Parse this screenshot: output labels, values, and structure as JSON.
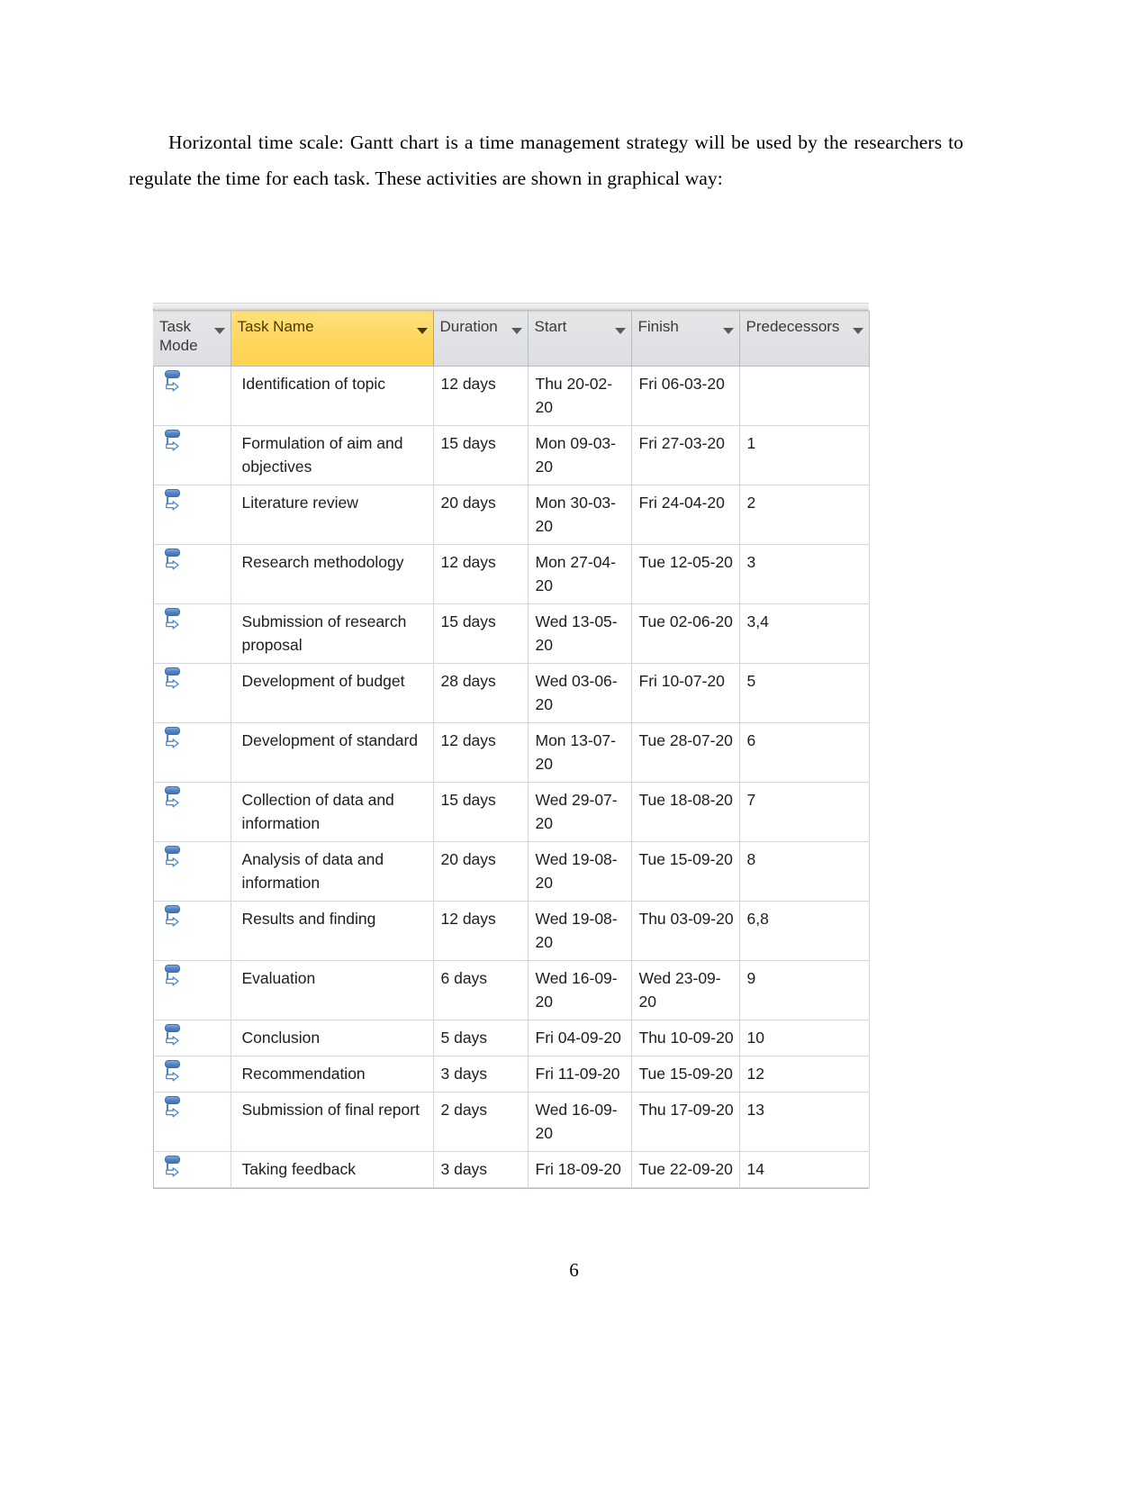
{
  "document": {
    "paragraph": "Horizontal time scale: Gantt chart is a time management strategy will be used by the researchers to regulate the time for each task. These activities are shown in graphical way:",
    "page_number": "6"
  },
  "gantt_table": {
    "highlight_color": "#ffd65e",
    "icon_color": "#4f85c8",
    "columns": [
      {
        "label": "Task Mode",
        "key": "task_mode",
        "highlighted": false
      },
      {
        "label": "Task Name",
        "key": "task_name",
        "highlighted": true
      },
      {
        "label": "Duration",
        "key": "duration",
        "highlighted": false
      },
      {
        "label": "Start",
        "key": "start",
        "highlighted": false
      },
      {
        "label": "Finish",
        "key": "finish",
        "highlighted": false
      },
      {
        "label": "Predecessors",
        "key": "predecessors",
        "highlighted": false
      }
    ],
    "rows": [
      {
        "mode_icon": "auto-scheduled-icon",
        "task_name": "Identification of topic",
        "duration": "12 days",
        "start": "Thu 20-02-20",
        "finish": "Fri 06-03-20",
        "predecessors": ""
      },
      {
        "mode_icon": "auto-scheduled-icon",
        "task_name": "Formulation of aim and objectives",
        "duration": "15 days",
        "start": "Mon 09-03-20",
        "finish": "Fri 27-03-20",
        "predecessors": "1"
      },
      {
        "mode_icon": "auto-scheduled-icon",
        "task_name": "Literature review",
        "duration": "20 days",
        "start": "Mon 30-03-20",
        "finish": "Fri 24-04-20",
        "predecessors": "2"
      },
      {
        "mode_icon": "auto-scheduled-icon",
        "task_name": "Research methodology",
        "duration": "12 days",
        "start": "Mon 27-04-20",
        "finish": "Tue 12-05-20",
        "predecessors": "3"
      },
      {
        "mode_icon": "auto-scheduled-icon",
        "task_name": "Submission of research proposal",
        "duration": "15 days",
        "start": "Wed 13-05-20",
        "finish": "Tue 02-06-20",
        "predecessors": "3,4"
      },
      {
        "mode_icon": "auto-scheduled-icon",
        "task_name": "Development of budget",
        "duration": "28 days",
        "start": "Wed 03-06-20",
        "finish": "Fri 10-07-20",
        "predecessors": "5"
      },
      {
        "mode_icon": "auto-scheduled-icon",
        "task_name": "Development of standard",
        "duration": "12 days",
        "start": "Mon 13-07-20",
        "finish": "Tue 28-07-20",
        "predecessors": "6"
      },
      {
        "mode_icon": "auto-scheduled-icon",
        "task_name": "Collection of data and information",
        "duration": "15 days",
        "start": "Wed 29-07-20",
        "finish": "Tue 18-08-20",
        "predecessors": "7"
      },
      {
        "mode_icon": "auto-scheduled-icon",
        "task_name": "Analysis of data and information",
        "duration": "20 days",
        "start": "Wed 19-08-20",
        "finish": "Tue 15-09-20",
        "predecessors": "8"
      },
      {
        "mode_icon": "auto-scheduled-icon",
        "task_name": "Results and finding",
        "duration": "12 days",
        "start": "Wed 19-08-20",
        "finish": "Thu 03-09-20",
        "predecessors": "6,8"
      },
      {
        "mode_icon": "auto-scheduled-icon",
        "task_name": "Evaluation",
        "duration": "6 days",
        "start": "Wed 16-09-20",
        "finish": "Wed 23-09-20",
        "predecessors": "9"
      },
      {
        "mode_icon": "auto-scheduled-icon",
        "task_name": "Conclusion",
        "duration": "5 days",
        "start": "Fri 04-09-20",
        "finish": "Thu 10-09-20",
        "predecessors": "10"
      },
      {
        "mode_icon": "auto-scheduled-icon",
        "task_name": "Recommendation",
        "duration": "3 days",
        "start": "Fri 11-09-20",
        "finish": "Tue 15-09-20",
        "predecessors": "12"
      },
      {
        "mode_icon": "auto-scheduled-icon",
        "task_name": "Submission of final report",
        "duration": "2 days",
        "start": "Wed 16-09-20",
        "finish": "Thu 17-09-20",
        "predecessors": "13"
      },
      {
        "mode_icon": "auto-scheduled-icon",
        "task_name": "Taking feedback",
        "duration": "3 days",
        "start": "Fri 18-09-20",
        "finish": "Tue 22-09-20",
        "predecessors": "14"
      }
    ]
  }
}
